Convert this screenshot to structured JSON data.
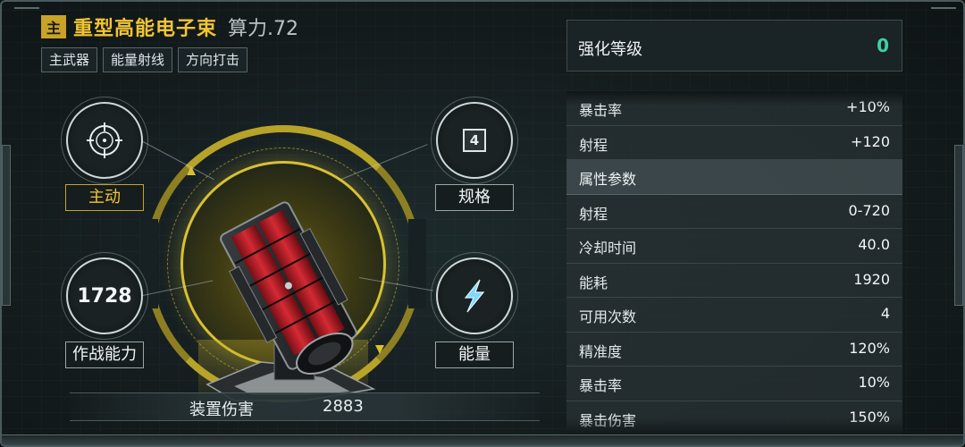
{
  "header": {
    "badge": "主",
    "weapon_name": "重型高能电子束",
    "power": "算力.72",
    "tags": [
      "主武器",
      "能量射线",
      "方向打击"
    ]
  },
  "nodes": {
    "active": {
      "icon": "crosshair-icon",
      "label": "主动"
    },
    "spec": {
      "value": "4",
      "label": "规格"
    },
    "combat": {
      "value": "1728",
      "label": "作战能力"
    },
    "energy": {
      "icon": "lightning-icon",
      "label": "能量"
    }
  },
  "damage": {
    "label": "装置伤害",
    "value": "2883"
  },
  "panel": {
    "enhance_label": "强化等级",
    "enhance_value": "0",
    "bonus_rows": [
      {
        "k": "暴击率",
        "v": "+10%"
      },
      {
        "k": "射程",
        "v": "+120"
      }
    ],
    "section_title": "属性参数",
    "attr_rows": [
      {
        "k": "射程",
        "v": "0-720"
      },
      {
        "k": "冷却时间",
        "v": "40.0"
      },
      {
        "k": "能耗",
        "v": "1920"
      },
      {
        "k": "可用次数",
        "v": "4"
      },
      {
        "k": "精准度",
        "v": "120%"
      },
      {
        "k": "暴击率",
        "v": "10%"
      },
      {
        "k": "暴击伤害",
        "v": "150%"
      }
    ]
  },
  "colors": {
    "gold": "#f2c531",
    "teal": "#3ed0a6",
    "ring": "#d8c033",
    "cannon_red": "#c0202a"
  }
}
